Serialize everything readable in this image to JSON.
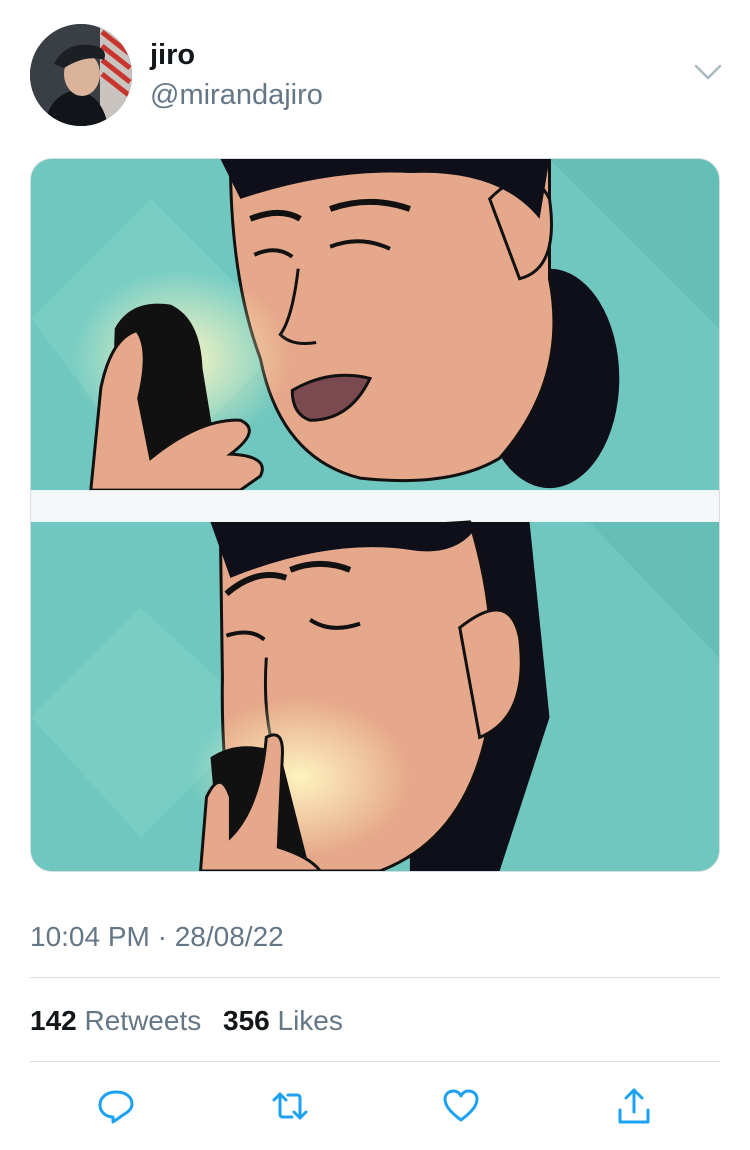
{
  "tweet": {
    "author": {
      "name": "jiro",
      "handle": "@mirandajiro"
    },
    "timestamp": "10:04 PM · 28/08/22",
    "stats": {
      "retweets_count": "142",
      "retweets_label": "Retweets",
      "likes_count": "356",
      "likes_label": "Likes"
    },
    "actions": [
      "reply-icon",
      "retweet-icon",
      "like-icon",
      "share-icon"
    ]
  },
  "colors": {
    "secondary_text": "#657786",
    "primary_text": "#14171a",
    "icon": "#1da1f2",
    "meme_background": "#6fc7bf"
  }
}
